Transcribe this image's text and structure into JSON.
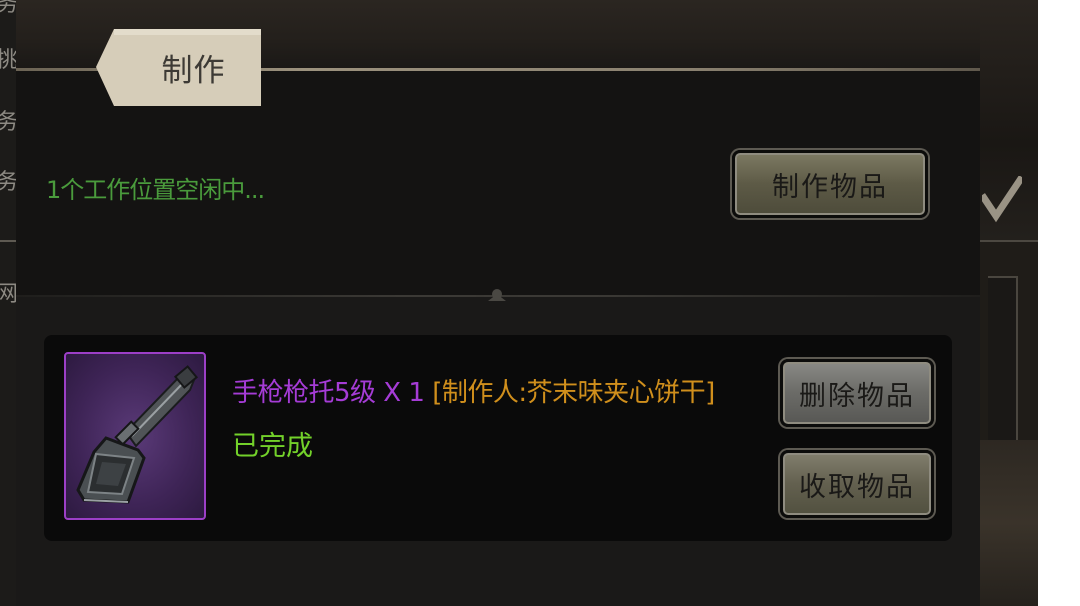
{
  "background": {
    "left_glyphs": [
      "务",
      "挑",
      "务",
      "务",
      "网"
    ]
  },
  "header": {
    "tab_label": "制作"
  },
  "workshop": {
    "status": "1个工作位置空闲中...",
    "make_button": "制作物品"
  },
  "item": {
    "name": "手枪枪托5级 X 1",
    "maker_prefix": "[制作人:",
    "maker_name": "芥末味夹心饼干",
    "maker_suffix": "]",
    "state": "已完成",
    "icon": "pistol-stock-icon",
    "rarity_color": "#a53cd6",
    "delete_button": "删除物品",
    "collect_button": "收取物品"
  },
  "colors": {
    "status_green": "#4a9b3c",
    "completed_green": "#73d12a",
    "maker_orange": "#d08f1c",
    "panel_bg": "#131211"
  }
}
